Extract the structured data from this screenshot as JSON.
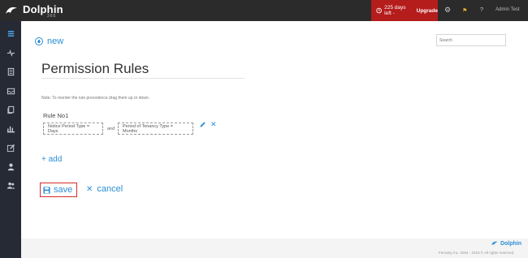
{
  "app": {
    "logo_text": "Dolphin",
    "logo_sub": "365"
  },
  "topbar": {
    "trial_text": "225 days left -",
    "upgrade_label": "Upgrade",
    "gear_icon": "gear-icon",
    "flag_icon": "flag-icon",
    "help_label": "?",
    "admin_label": "Admin Test"
  },
  "sidebar": {
    "items": [
      {
        "icon": "menu-icon"
      },
      {
        "icon": "pulse-icon"
      },
      {
        "icon": "document-icon"
      },
      {
        "icon": "inbox-icon"
      },
      {
        "icon": "copy-icon"
      },
      {
        "icon": "bar-chart-icon"
      },
      {
        "icon": "edit-icon"
      },
      {
        "icon": "user-icon"
      },
      {
        "icon": "users-icon"
      }
    ]
  },
  "main": {
    "new_label": "new",
    "search_placeholder": "Search",
    "title": "Permission Rules",
    "note": "Note: To reorder the rule precedence drag them up or down.",
    "rule": {
      "label": "Rule No1",
      "condition1": "Notice Period Type = Days",
      "and_label": "and",
      "condition2": "Period of Tenancy Type = Months"
    },
    "add_label": "+ add",
    "save_label": "save",
    "cancel_label": "cancel"
  },
  "footer": {
    "logo_text": "Dolphin",
    "copyright": "Ferranty Inc. 2004 - 2019 © All rights reserved."
  },
  "colors": {
    "accent": "#2c8fd6",
    "trial_bg": "#b51c1c",
    "sidebar_bg": "#252a35",
    "topbar_bg": "#2b2b2b",
    "save_border": "#d62b2b"
  }
}
